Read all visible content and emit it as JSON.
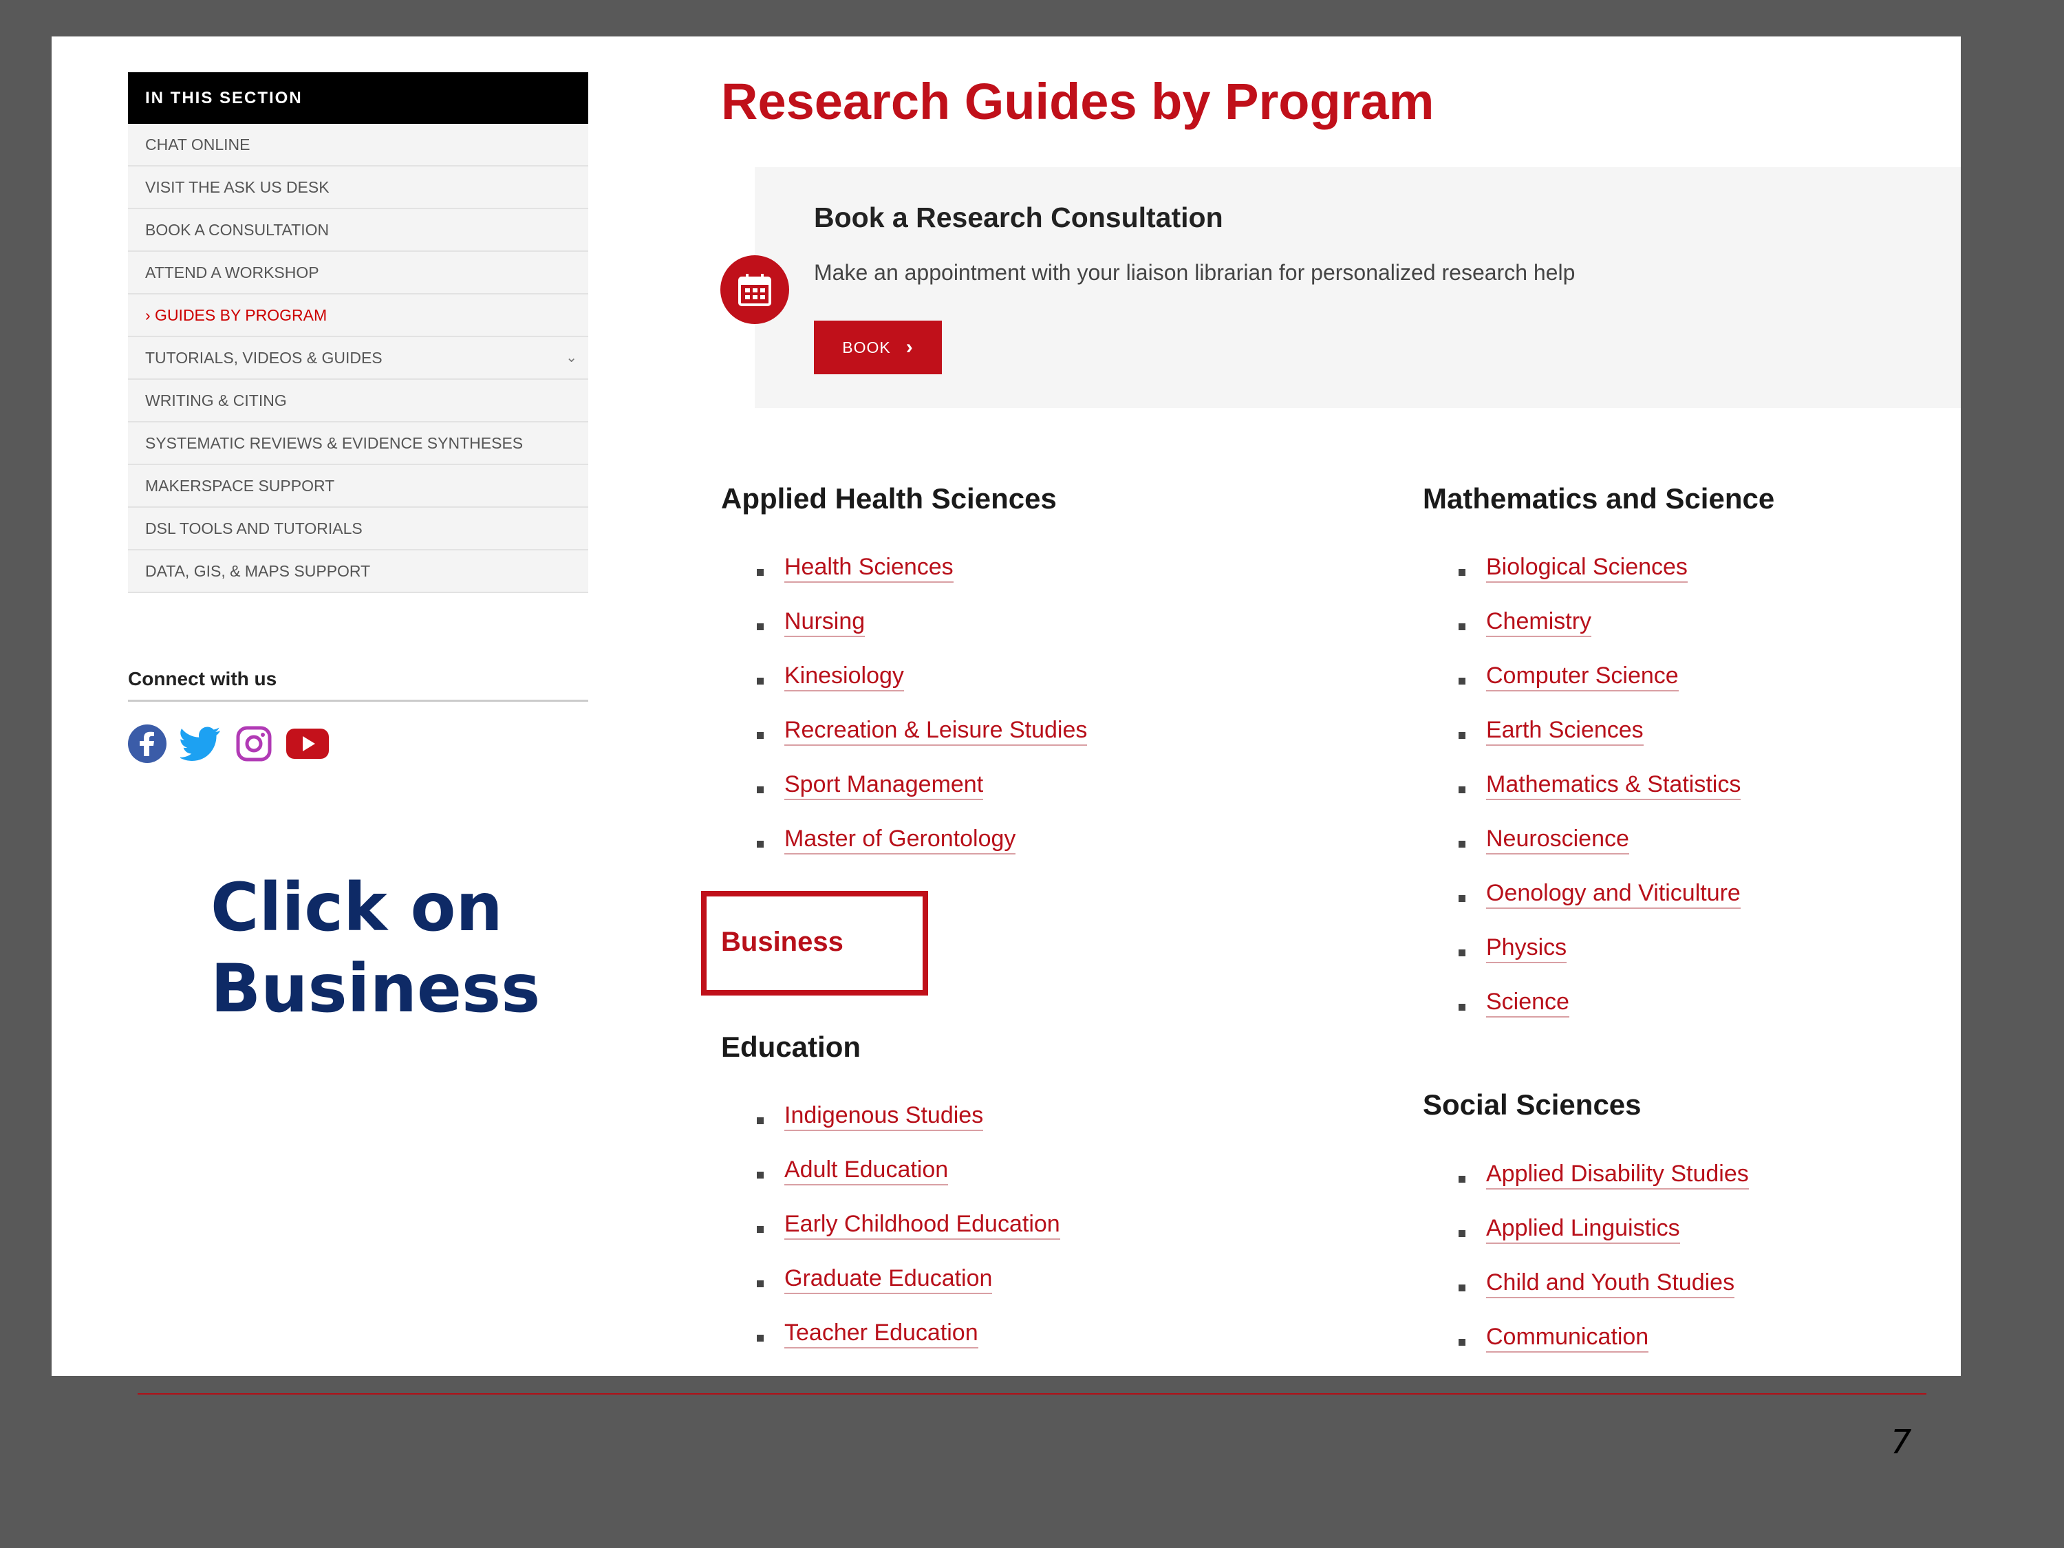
{
  "sidebar": {
    "header": "IN THIS SECTION",
    "items": [
      {
        "label": "CHAT ONLINE"
      },
      {
        "label": "VISIT THE ASK US DESK"
      },
      {
        "label": "BOOK A CONSULTATION"
      },
      {
        "label": "ATTEND A WORKSHOP"
      },
      {
        "label": "› GUIDES BY PROGRAM"
      },
      {
        "label": "TUTORIALS, VIDEOS & GUIDES"
      },
      {
        "label": "WRITING & CITING"
      },
      {
        "label": "SYSTEMATIC REVIEWS & EVIDENCE SYNTHESES"
      },
      {
        "label": "MAKERSPACE SUPPORT"
      },
      {
        "label": "DSL TOOLS AND TUTORIALS"
      },
      {
        "label": "DATA, GIS, & MAPS SUPPORT"
      }
    ],
    "connect_title": "Connect with us",
    "social_icons": [
      "facebook-icon",
      "twitter-icon",
      "instagram-icon",
      "youtube-icon"
    ]
  },
  "callout": {
    "line1": "Click on",
    "line2": "Business"
  },
  "main": {
    "title": "Research Guides by Program",
    "consultation": {
      "title": "Book a Research Consultation",
      "description": "Make an appointment with your liaison librarian for personalized research help",
      "button_label": "BOOK",
      "icon": "calendar-icon"
    },
    "sections": {
      "applied_health": {
        "heading": "Applied Health Sciences",
        "links": [
          "Health Sciences",
          "Nursing",
          "Kinesiology",
          "Recreation & Leisure Studies",
          "Sport Management",
          "Master of Gerontology"
        ]
      },
      "business": {
        "heading": "Business"
      },
      "education": {
        "heading": "Education",
        "links": [
          "Indigenous Studies",
          "Adult Education",
          "Early Childhood Education",
          "Graduate Education",
          "Teacher Education"
        ]
      },
      "math_science": {
        "heading": "Mathematics and Science",
        "links": [
          "Biological Sciences",
          "Chemistry",
          "Computer Science",
          "Earth Sciences",
          "Mathematics & Statistics",
          "Neuroscience",
          "Oenology and Viticulture",
          "Physics",
          "Science"
        ]
      },
      "social_sciences": {
        "heading": "Social Sciences",
        "links": [
          "Applied Disability Studies",
          "Applied Linguistics",
          "Child and Youth Studies",
          "Communication"
        ]
      }
    }
  },
  "slide": {
    "page_number": "7"
  },
  "colors": {
    "brand_red": "#c0101a",
    "callout_navy": "#0e2a66",
    "slide_bg": "#595959"
  }
}
